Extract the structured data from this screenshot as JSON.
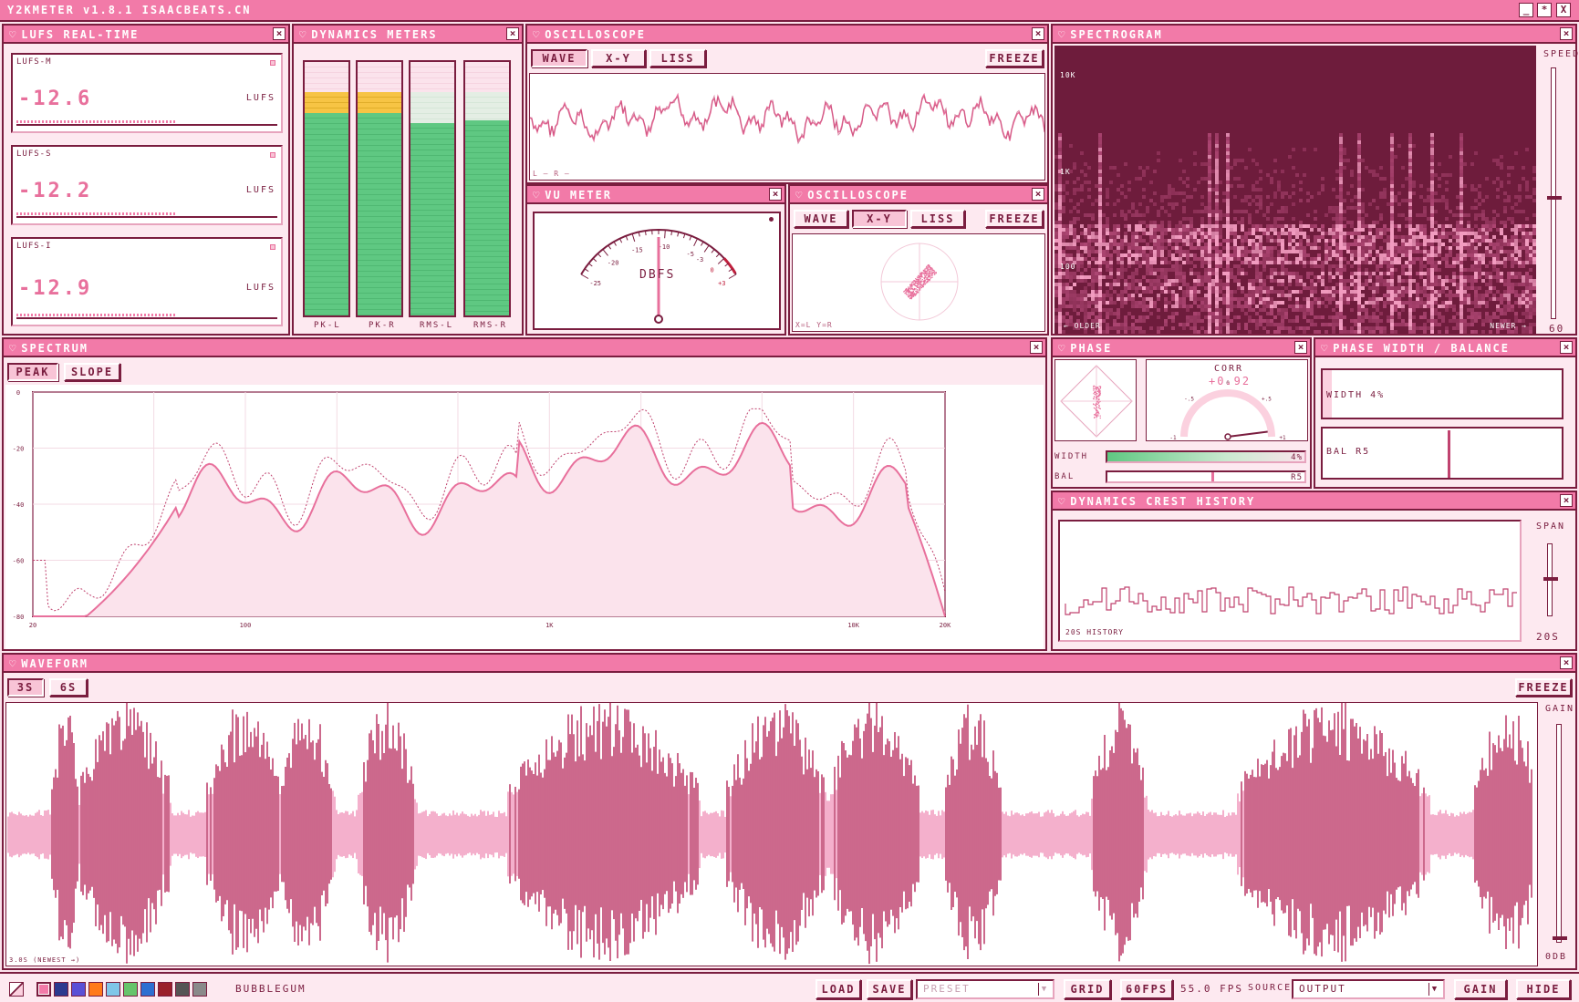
{
  "app": {
    "title": "Y2KMETER v1.8.1  ISAACBEATS.CN",
    "minimize": "_",
    "maximize": "*",
    "close": "X"
  },
  "lufs": {
    "title": "LUFS REAL-TIME",
    "meters": [
      {
        "name": "LUFS-M",
        "value": "-12.6",
        "unit": "LUFS",
        "fill": 0.6
      },
      {
        "name": "LUFS-S",
        "value": "-12.2",
        "unit": "LUFS",
        "fill": 0.6
      },
      {
        "name": "LUFS-I",
        "value": "-12.9",
        "unit": "LUFS",
        "fill": 0.6
      }
    ]
  },
  "dynamics": {
    "title": "DYNAMICS METERS",
    "meters": [
      {
        "label": "PK-L",
        "level": 0.88
      },
      {
        "label": "PK-R",
        "level": 0.88
      },
      {
        "label": "RMS-L",
        "level": 0.76
      },
      {
        "label": "RMS-R",
        "level": 0.77
      }
    ]
  },
  "osc1": {
    "title": "OSCILLOSCOPE",
    "tabs": [
      "WAVE",
      "X-Y",
      "LISS"
    ],
    "active_tab": "WAVE",
    "freeze": "FREEZE",
    "legend": "L —  R —"
  },
  "vu": {
    "title": "VU METER",
    "unit": "DBFS",
    "ticks": [
      "-25",
      "-20",
      "-15",
      "-10",
      "-5",
      "-3",
      "0",
      "+3"
    ],
    "reading_db": -11
  },
  "osc2": {
    "title": "OSCILLOSCOPE",
    "tabs": [
      "WAVE",
      "X-Y",
      "LISS"
    ],
    "active_tab": "X-Y",
    "freeze": "FREEZE",
    "legend": "X=L  Y=R"
  },
  "spectrogram": {
    "title": "SPECTROGRAM",
    "speed_label": "SPEED",
    "speed_value": "60",
    "freq_labels": [
      "10K",
      "1K",
      "100"
    ],
    "older": "← OLDER",
    "newer": "NEWER →"
  },
  "spectrum": {
    "title": "SPECTRUM",
    "tabs": [
      "PEAK",
      "SLOPE"
    ],
    "active_tab": "PEAK",
    "y_ticks": [
      "0",
      "-20",
      "-40",
      "-60",
      "-80"
    ],
    "x_ticks": [
      "20",
      "100",
      "1K",
      "10K",
      "20K"
    ]
  },
  "phase": {
    "title": "PHASE",
    "corr_label": "CORR",
    "corr_value": "+0.92",
    "corr_ticks": [
      "-1",
      "-.5",
      "0",
      "+.5",
      "+1"
    ],
    "width_label": "WIDTH",
    "width_value": "4%",
    "bal_label": "BAL",
    "bal_value": "R5"
  },
  "phasewidth": {
    "title": "PHASE WIDTH / BALANCE",
    "width_text": "WIDTH 4%",
    "bal_text": "BAL R5"
  },
  "crest": {
    "title": "DYNAMICS CREST HISTORY",
    "span_label": "SPAN",
    "span_value": "20S",
    "history_label": "20S HISTORY"
  },
  "waveform": {
    "title": "WAVEFORM",
    "tabs": [
      "3S",
      "6S"
    ],
    "active_tab": "3S",
    "freeze": "FREEZE",
    "gain_label": "GAIN",
    "gain_value": "0DB",
    "time_label": "3.0S  (NEWEST →)"
  },
  "bottom": {
    "theme_name": "BUBBLEGUM",
    "swatches": [
      "#f27aa8",
      "#2b3a8f",
      "#5a4fd6",
      "#ff7a1a",
      "#7fc6e8",
      "#66c46b",
      "#2d6fd1",
      "#9a1f2a",
      "#555555",
      "#8a8a8a"
    ],
    "load": "LOAD",
    "save": "SAVE",
    "preset_placeholder": "PRESET",
    "grid": "GRID",
    "fps_button": "60FPS",
    "fps_readout": "55.0 FPS",
    "source_label": "SOURCE",
    "source_value": "OUTPUT",
    "gain": "GAIN",
    "hide": "HIDE"
  },
  "colors": {
    "accent": "#f27aa8",
    "outline": "#7a1d3f",
    "panel": "#fde9f0",
    "meter_green": "#5fc882",
    "meter_yellow": "#f7c444"
  }
}
